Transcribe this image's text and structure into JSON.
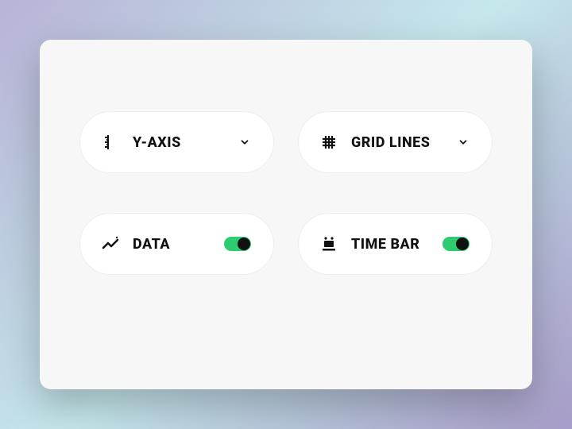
{
  "controls": {
    "yaxis": {
      "label": "Y-AXIS",
      "type": "dropdown"
    },
    "grid": {
      "label": "GRID LINES",
      "type": "dropdown"
    },
    "data": {
      "label": "DATA",
      "type": "toggle",
      "on": true
    },
    "timebar": {
      "label": "TIME BAR",
      "type": "toggle",
      "on": true
    }
  }
}
